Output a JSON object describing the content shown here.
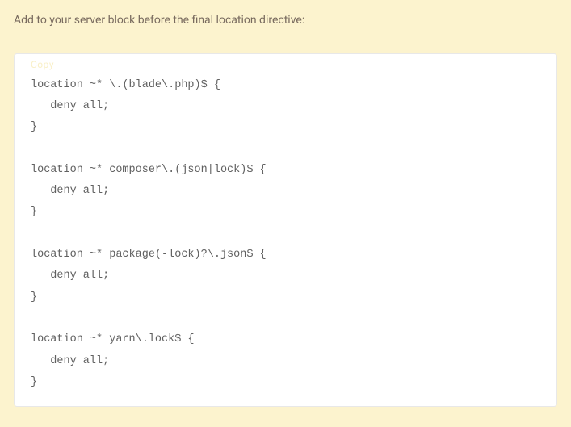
{
  "intro": "Add to your server block before the final location directive:",
  "copy_label": "Copy",
  "code": "location ~* \\.(blade\\.php)$ {\n   deny all;\n}\n\nlocation ~* composer\\.(json|lock)$ {\n   deny all;\n}\n\nlocation ~* package(-lock)?\\.json$ {\n   deny all;\n}\n\nlocation ~* yarn\\.lock$ {\n   deny all;\n}"
}
